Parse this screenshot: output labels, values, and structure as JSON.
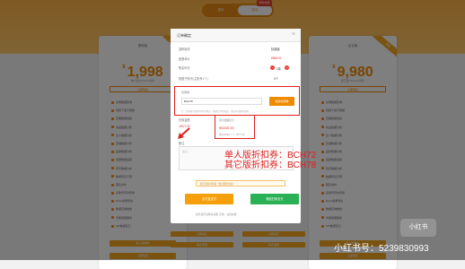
{
  "hero": {
    "tab1": "按年",
    "tab2": "包月",
    "flag": "限时优惠"
  },
  "cards": [
    {
      "plan": "基础版",
      "currency": "¥",
      "price": "1,998",
      "unit": "/年",
      "sub": "单人版 BCH72 抵扣",
      "buy_label": "立即购买",
      "ribbon": "热销",
      "features": [
        "全网数据查询",
        "视频下载不限量",
        "直播数据追踪",
        "商品数据分析",
        "达人数据分析",
        "店铺数据分析",
        "品牌数据分析",
        "话题数据追踪",
        "音乐数据分析",
        "数据导出不限",
        "团队协作",
        "多账号同时登录",
        "Excel批量导出",
        "数据定制推送",
        "专属客服服务",
        "API数据接口",
        "视频监控",
        "直播间监控",
        "关键词监控"
      ],
      "btn1": "加入购物车",
      "btn2": "立即购买"
    },
    {
      "plan": "企业版",
      "currency": "¥",
      "price": "9,980",
      "unit": "/年",
      "sub": "其它版 BCH78 抵扣",
      "buy_label": "立即购买",
      "ribbon": "超值",
      "features": [
        "全网数据查询",
        "视频下载不限量",
        "直播数据追踪",
        "商品数据分析",
        "达人数据分析",
        "店铺数据分析",
        "品牌数据分析",
        "话题数据追踪",
        "音乐数据分析",
        "数据导出不限",
        "团队协作",
        "多账号同时登录",
        "Excel批量导出",
        "数据定制推送",
        "专属客服服务",
        "API数据接口",
        "视频监控",
        "直播间监控",
        "关键词监控"
      ],
      "btn1": "加入购物车",
      "btn2": "立即购买"
    }
  ],
  "mid_buttons": [
    "立即购买",
    "立即购买",
    "联系客服",
    "联系客服"
  ],
  "modal": {
    "title": "订单确定",
    "close": "×",
    "rows": [
      {
        "label": "选购版本",
        "value": "标准版"
      },
      {
        "label": "套餐单价",
        "value": "¥568.00"
      },
      {
        "label": "购买时长",
        "value": "1年"
      },
      {
        "label": "数据子账号(主账号1个)",
        "value": "0个"
      }
    ],
    "coupon": {
      "label": "优惠券",
      "code": "BCH78",
      "use_btn": "使用优惠券",
      "note": "注：优惠券只能用于本次购买，使用后不可退还，请在有效期内使用"
    },
    "total_label": "优惠金额",
    "total_value": "-¥577.00",
    "paid": {
      "label": "应付金额(元)",
      "value": "¥5430.00",
      "note": "原价¥6007 × 1 - ¥577.00"
    },
    "remark_label": "备注",
    "remark_placeholder": "备注...",
    "coupons_overlay": [
      "单人版折扣券：BCH72",
      "其它版折扣券：BCH78"
    ],
    "agree": "我已阅读并同意《会员服务协议》",
    "alipay_btn": "支付宝支付",
    "wechat_btn": "微信扫码支付",
    "footer": "如有疑问请联系客服 咨询：在线客服"
  },
  "watermark": {
    "badge": "小红书",
    "id": "小红书号：5239830993"
  }
}
